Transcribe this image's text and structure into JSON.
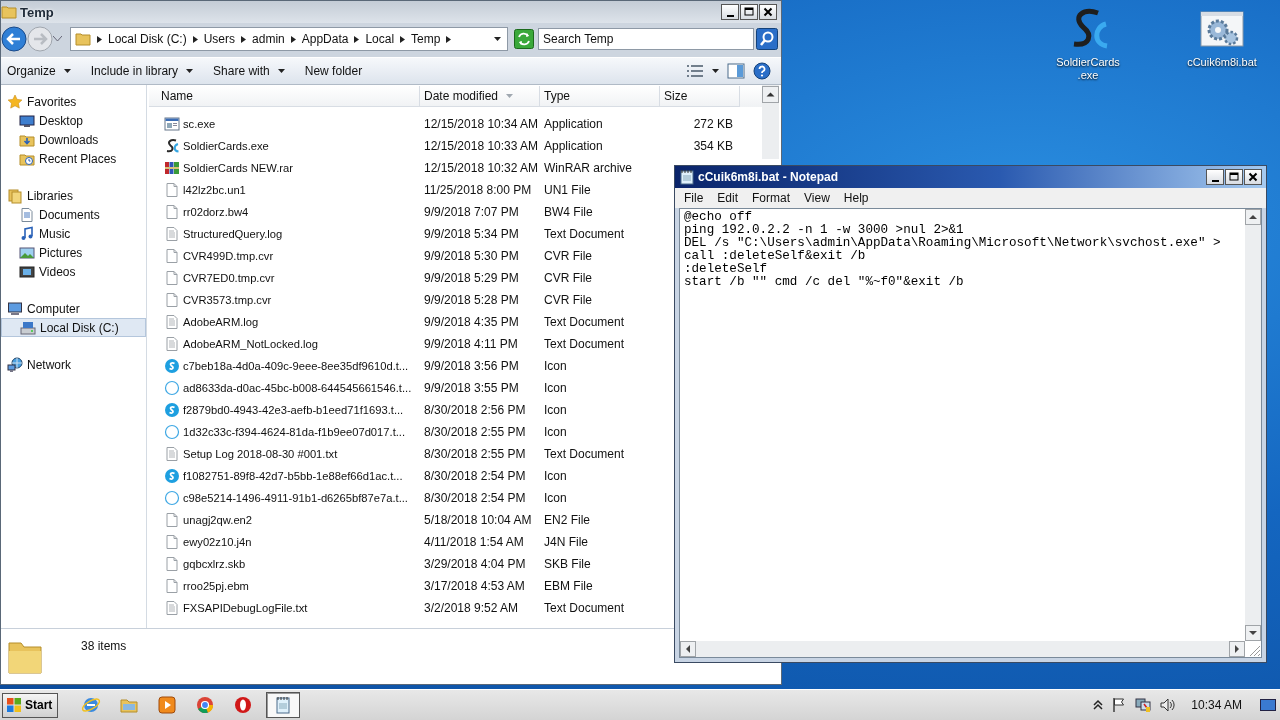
{
  "desktop_icons": [
    {
      "kind": "soldier",
      "lines": [
        "SoldierCards",
        ".exe"
      ],
      "selected": false
    },
    {
      "kind": "batch",
      "lines": [
        "cCuik6m8i.bat"
      ],
      "selected": false
    }
  ],
  "explorer": {
    "title": "Temp",
    "path": [
      "Local Disk (C:)",
      "Users",
      "admin",
      "AppData",
      "Local",
      "Temp"
    ],
    "search": {
      "placeholder": "Search Temp"
    },
    "toolbar": [
      {
        "label": "Organize",
        "dropdown": true
      },
      {
        "label": "Include in library",
        "dropdown": true
      },
      {
        "label": "Share with",
        "dropdown": true
      },
      {
        "label": "New folder",
        "dropdown": false
      }
    ],
    "nav": [
      {
        "kind": "favorites",
        "label": "Favorites",
        "selected": false,
        "children": [
          {
            "kind": "desktop",
            "label": "Desktop",
            "selected": false
          },
          {
            "kind": "downloads",
            "label": "Downloads",
            "selected": false
          },
          {
            "kind": "recent",
            "label": "Recent Places",
            "selected": false
          }
        ]
      },
      {
        "kind": "libraries",
        "label": "Libraries",
        "selected": false,
        "children": [
          {
            "kind": "documents",
            "label": "Documents",
            "selected": false
          },
          {
            "kind": "music",
            "label": "Music",
            "selected": false
          },
          {
            "kind": "pictures",
            "label": "Pictures",
            "selected": false
          },
          {
            "kind": "videos",
            "label": "Videos",
            "selected": false
          }
        ]
      },
      {
        "kind": "computer",
        "label": "Computer",
        "selected": false,
        "children": [
          {
            "kind": "disk",
            "label": "Local Disk (C:)",
            "selected": true
          }
        ]
      },
      {
        "kind": "network",
        "label": "Network",
        "selected": false
      }
    ],
    "columns": [
      {
        "label": "Name",
        "sorted": false
      },
      {
        "label": "Date modified",
        "sorted": true
      },
      {
        "label": "Type",
        "sorted": false
      },
      {
        "label": "Size",
        "sorted": false
      }
    ],
    "rows": [
      {
        "kind": "app",
        "name": "sc.exe",
        "date": "12/15/2018 10:34 AM",
        "type": "Application",
        "size": "272 KB"
      },
      {
        "kind": "soldier",
        "name": "SoldierCards.exe",
        "date": "12/15/2018 10:33 AM",
        "type": "Application",
        "size": "354 KB"
      },
      {
        "kind": "archive",
        "name": "SoldierCards NEW.rar",
        "date": "12/15/2018 10:32 AM",
        "type": "WinRAR archive"
      },
      {
        "kind": "file",
        "name": "l42lz2bc.un1",
        "date": "11/25/2018 8:00 PM",
        "type": "UN1 File"
      },
      {
        "kind": "file",
        "name": "rr02dorz.bw4",
        "date": "9/9/2018 7:07 PM",
        "type": "BW4 File"
      },
      {
        "kind": "text",
        "name": "StructuredQuery.log",
        "date": "9/9/2018 5:34 PM",
        "type": "Text Document"
      },
      {
        "kind": "file",
        "name": "CVR499D.tmp.cvr",
        "date": "9/9/2018 5:30 PM",
        "type": "CVR File"
      },
      {
        "kind": "file",
        "name": "CVR7ED0.tmp.cvr",
        "date": "9/9/2018 5:29 PM",
        "type": "CVR File"
      },
      {
        "kind": "file",
        "name": "CVR3573.tmp.cvr",
        "date": "9/9/2018 5:28 PM",
        "type": "CVR File"
      },
      {
        "kind": "text",
        "name": "AdobeARM.log",
        "date": "9/9/2018 4:35 PM",
        "type": "Text Document"
      },
      {
        "kind": "text",
        "name": "AdobeARM_NotLocked.log",
        "date": "9/9/2018 4:11 PM",
        "type": "Text Document"
      },
      {
        "kind": "logo",
        "name": "c7beb18a-4d0a-409c-9eee-8ee35df9610d.t...",
        "date": "9/9/2018 3:56 PM",
        "type": "Icon"
      },
      {
        "kind": "ring",
        "name": "ad8633da-d0ac-45bc-b008-644545661546.t...",
        "date": "9/9/2018 3:55 PM",
        "type": "Icon"
      },
      {
        "kind": "logo",
        "name": "f2879bd0-4943-42e3-aefb-b1eed71f1693.t...",
        "date": "8/30/2018 2:56 PM",
        "type": "Icon"
      },
      {
        "kind": "ring",
        "name": "1d32c33c-f394-4624-81da-f1b9ee07d017.t...",
        "date": "8/30/2018 2:55 PM",
        "type": "Icon"
      },
      {
        "kind": "text",
        "name": "Setup Log 2018-08-30 #001.txt",
        "date": "8/30/2018 2:55 PM",
        "type": "Text Document"
      },
      {
        "kind": "logo",
        "name": "f1082751-89f8-42d7-b5bb-1e88ef66d1ac.t...",
        "date": "8/30/2018 2:54 PM",
        "type": "Icon"
      },
      {
        "kind": "ring",
        "name": "c98e5214-1496-4911-91b1-d6265bf87e7a.t...",
        "date": "8/30/2018 2:54 PM",
        "type": "Icon"
      },
      {
        "kind": "file",
        "name": "unagj2qw.en2",
        "date": "5/18/2018 10:04 AM",
        "type": "EN2 File"
      },
      {
        "kind": "file",
        "name": "ewy02z10.j4n",
        "date": "4/11/2018 1:54 AM",
        "type": "J4N File"
      },
      {
        "kind": "file",
        "name": "gqbcxlrz.skb",
        "date": "3/29/2018 4:04 PM",
        "type": "SKB File"
      },
      {
        "kind": "file",
        "name": "rroo25pj.ebm",
        "date": "3/17/2018 4:53 AM",
        "type": "EBM File"
      },
      {
        "kind": "text",
        "name": "FXSAPIDebugLogFile.txt",
        "date": "3/2/2018 9:52 AM",
        "type": "Text Document"
      }
    ],
    "status": "38 items"
  },
  "notepad": {
    "title": "cCuik6m8i.bat - Notepad",
    "menu": [
      "File",
      "Edit",
      "Format",
      "View",
      "Help"
    ],
    "lines": [
      "@echo off",
      "ping 192.0.2.2 -n 1 -w 3000 >nul 2>&1",
      "DEL /s \"C:\\Users\\admin\\AppData\\Roaming\\Microsoft\\Network\\svchost.exe\" >",
      "call :deleteSelf&exit /b",
      ":deleteSelf",
      "start /b \"\" cmd /c del \"%~f0\"&exit /b"
    ]
  },
  "taskbar": {
    "start": "Start",
    "apps": [
      {
        "kind": "ie",
        "active": false
      },
      {
        "kind": "explorer",
        "active": false
      },
      {
        "kind": "media",
        "active": false
      },
      {
        "kind": "chrome",
        "active": false
      },
      {
        "kind": "opera",
        "active": false
      },
      {
        "kind": "notepad",
        "active": true
      }
    ],
    "time": "10:34 AM"
  }
}
